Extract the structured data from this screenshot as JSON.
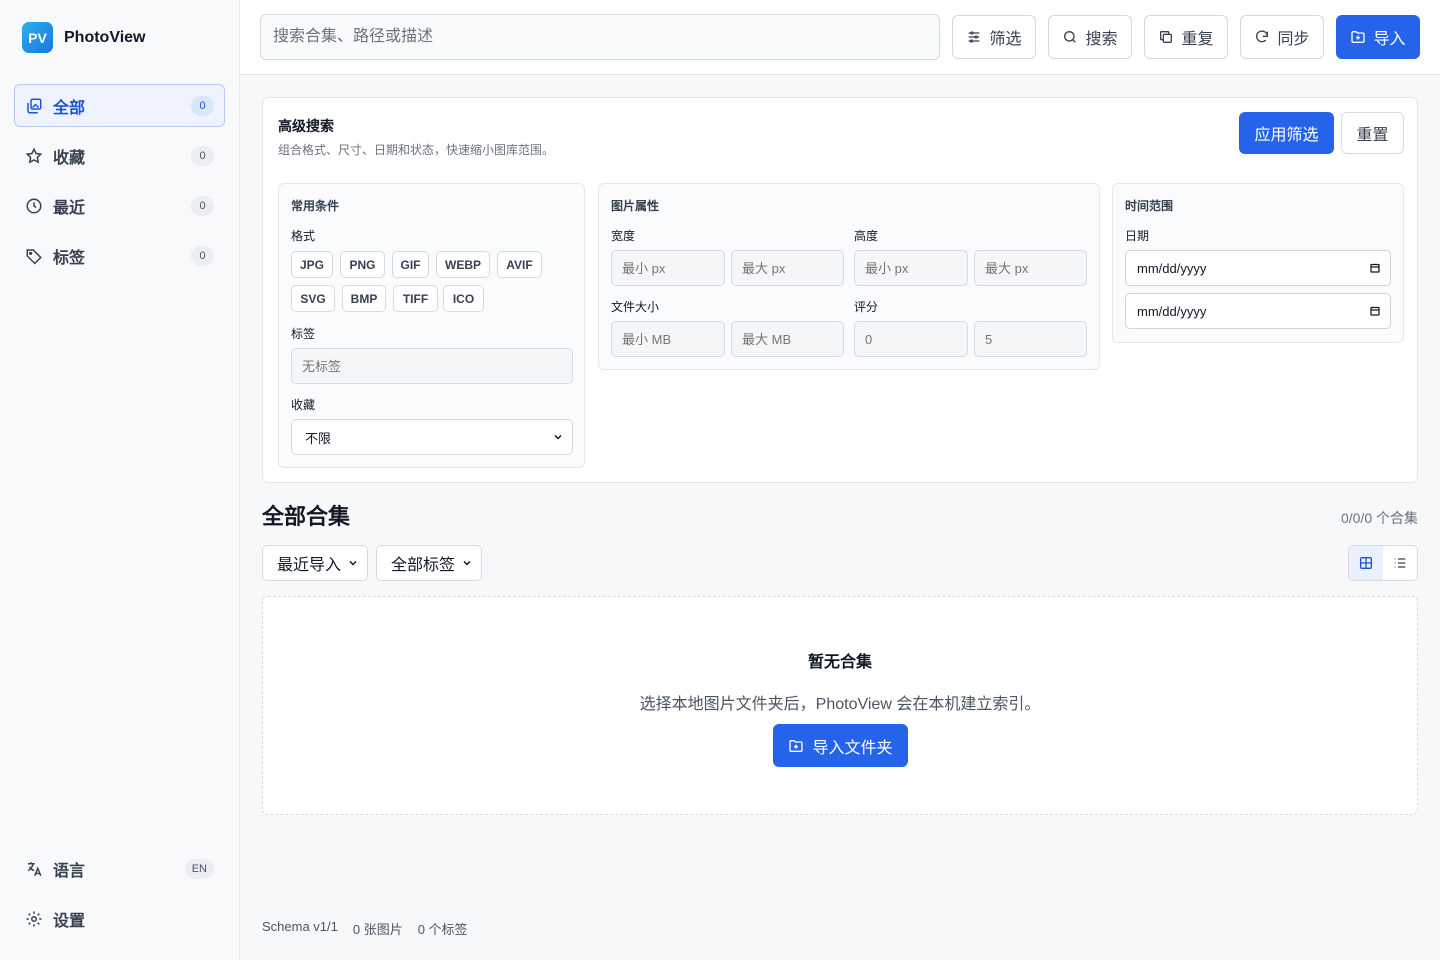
{
  "app": {
    "name": "PhotoView",
    "logo": "PV"
  },
  "sidebar": {
    "items": [
      {
        "label": "全部",
        "count": "0",
        "icon": "gallery-icon"
      },
      {
        "label": "收藏",
        "count": "0",
        "icon": "star-icon"
      },
      {
        "label": "最近",
        "count": "0",
        "icon": "clock-icon"
      },
      {
        "label": "标签",
        "count": "0",
        "icon": "tag-icon"
      }
    ],
    "bottom": [
      {
        "label": "语言",
        "badge": "EN",
        "icon": "translate-icon"
      },
      {
        "label": "设置",
        "icon": "gear-icon"
      }
    ]
  },
  "topbar": {
    "search_placeholder": "搜索合集、路径或描述",
    "filter": "筛选",
    "search": "搜索",
    "duplicate": "重复",
    "sync": "同步",
    "import": "导入"
  },
  "advanced": {
    "title": "高级搜索",
    "description": "组合格式、尺寸、日期和状态，快速缩小图库范围。",
    "apply": "应用筛选",
    "reset": "重置",
    "common": {
      "title": "常用条件",
      "format_label": "格式",
      "formats": [
        "JPG",
        "PNG",
        "GIF",
        "WEBP",
        "AVIF",
        "SVG",
        "BMP",
        "TIFF",
        "ICO"
      ],
      "tag_label": "标签",
      "tag_placeholder": "无标签",
      "favorite_label": "收藏",
      "favorite_value": "不限"
    },
    "attrs": {
      "title": "图片属性",
      "width_label": "宽度",
      "height_label": "高度",
      "width_min": "最小 px",
      "width_max": "最大 px",
      "height_min": "最小 px",
      "height_max": "最大 px",
      "size_label": "文件大小",
      "size_min": "最小 MB",
      "size_max": "最大 MB",
      "rating_label": "评分",
      "rating_min": "0",
      "rating_max": "5"
    },
    "time": {
      "title": "时间范围",
      "date_label": "日期",
      "date_from": "mm/dd/yyyy",
      "date_to": "mm/dd/yyyy"
    }
  },
  "collections": {
    "title": "全部合集",
    "count": "0/0/0 个合集",
    "sort": "最近导入",
    "tags": "全部标签",
    "empty_title": "暂无合集",
    "empty_desc": "选择本地图片文件夹后，PhotoView 会在本机建立索引。",
    "import_folder": "导入文件夹"
  },
  "footer": {
    "schema": "Schema v1/1",
    "images": "0 张图片",
    "tags": "0 个标签"
  },
  "colors": {
    "primary": "#2563eb",
    "active_bg": "#eef3ff"
  }
}
